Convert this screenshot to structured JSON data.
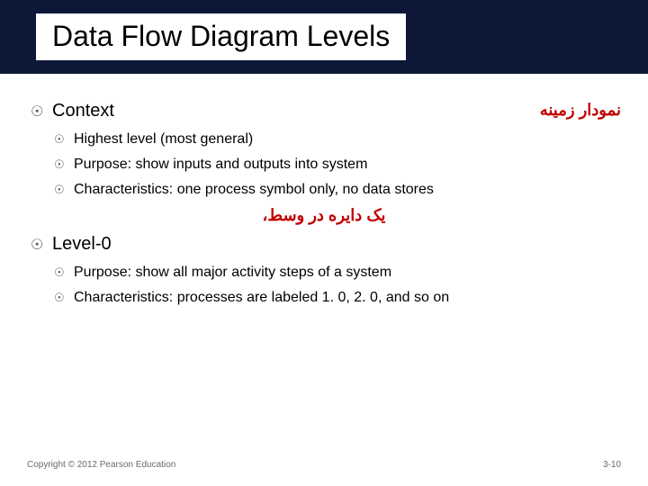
{
  "slide": {
    "title": "Data Flow Diagram Levels",
    "sections": [
      {
        "heading": "Context",
        "annotation_right": "نمودار زمینه",
        "items": [
          "Highest level (most general)",
          "Purpose: show inputs and outputs into system",
          "Characteristics: one process symbol only, no data stores"
        ],
        "annotation_below": "یک دایره در وسط،"
      },
      {
        "heading": "Level-0",
        "items": [
          "Purpose: show all major activity steps of a system",
          "Characteristics: processes are labeled 1. 0, 2. 0, and so on"
        ]
      }
    ],
    "footer": {
      "copyright": "Copyright © 2012 Pearson Education",
      "page": "3-10"
    }
  }
}
